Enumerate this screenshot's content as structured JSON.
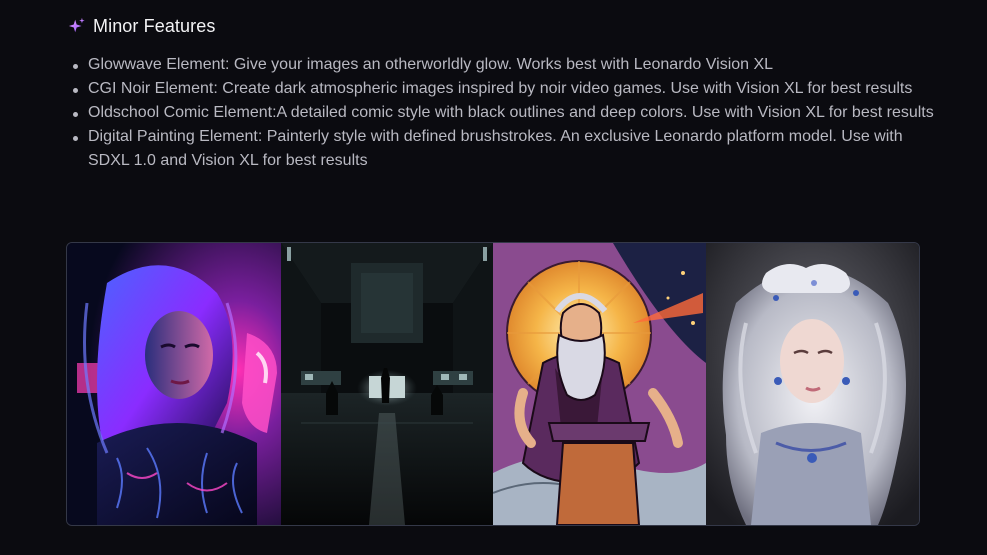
{
  "section": {
    "title": "Minor Features",
    "icon": "sparkle-icon",
    "accent_color": "#c77dff"
  },
  "features": [
    {
      "text": "Glowwave Element: Give your images an otherworldly glow. Works best with Leonardo Vision XL"
    },
    {
      "text": "CGI Noir Element: Create dark atmospheric images inspired by noir video games. Use with Vision XL for best results"
    },
    {
      "text": "Oldschool Comic Element:A detailed comic style with black outlines and deep colors. Use with Vision XL for best results"
    },
    {
      "text": "Digital Painting Element: Painterly style with defined brushstrokes. An exclusive Leonardo platform model. Use with SDXL 1.0 and Vision XL for best results"
    }
  ],
  "gallery": {
    "images": [
      {
        "subject": "glowwave-portrait"
      },
      {
        "subject": "cgi-noir-hall"
      },
      {
        "subject": "oldschool-comic-wizard"
      },
      {
        "subject": "digital-painting-portrait"
      }
    ]
  }
}
